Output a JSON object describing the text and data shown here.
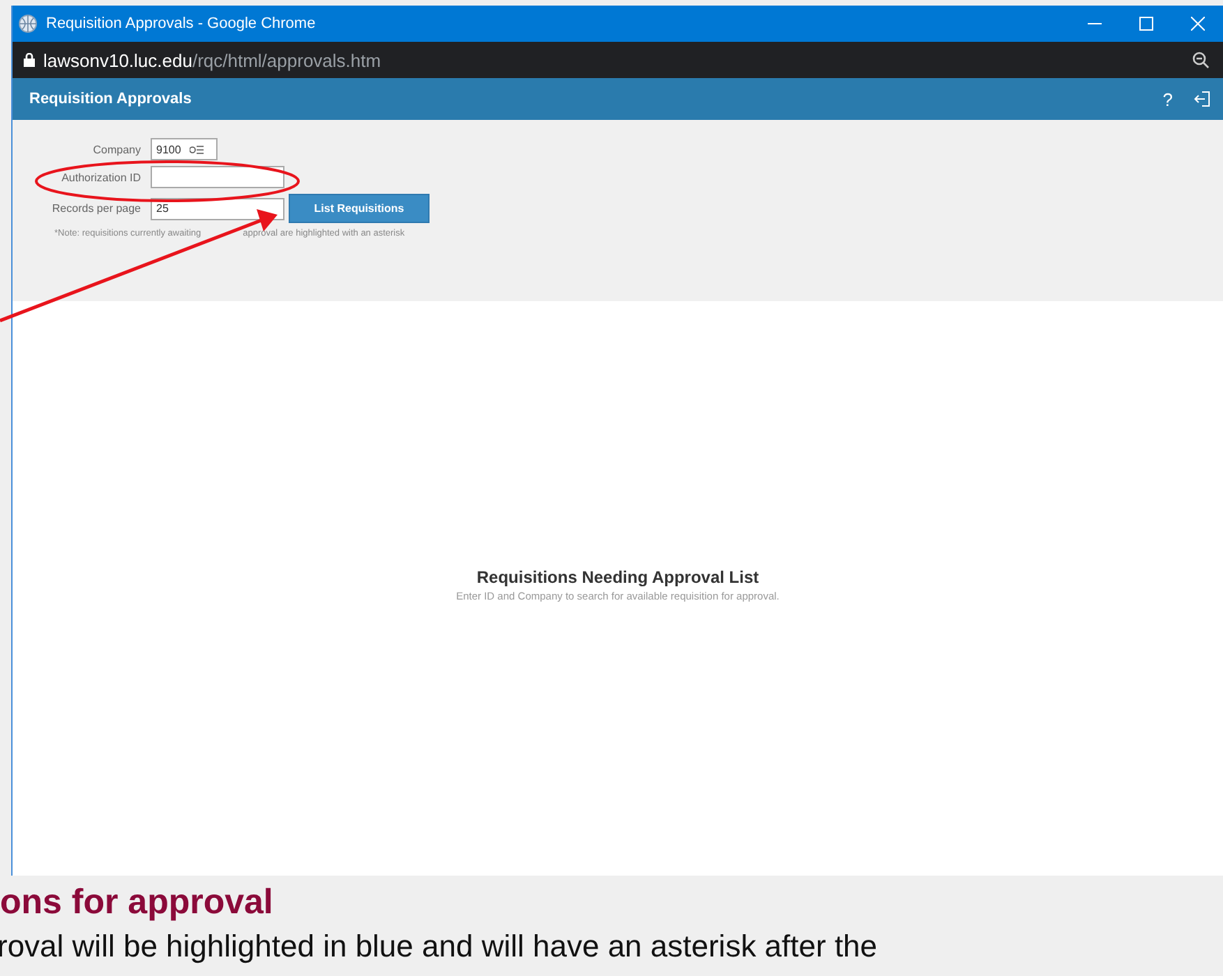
{
  "window": {
    "title": "Requisition Approvals - Google Chrome",
    "url_host": "lawsonv10.luc.edu",
    "url_path": "/rqc/html/approvals.htm"
  },
  "app": {
    "title": "Requisition Approvals",
    "help": "?"
  },
  "form": {
    "fields": [
      {
        "label": "Company",
        "value": "9100",
        "kind": "select"
      },
      {
        "label": "Authorization ID",
        "kind": "text"
      },
      {
        "label": "Records per page",
        "value": "25",
        "kind": "text"
      }
    ],
    "button": "List Requisitions",
    "note": [
      "*Note: requisitions currently awaiting",
      "approval are highlighted with an asterisk"
    ]
  },
  "empty_state": {
    "title": "Requisitions Needing Approval List",
    "message": "Enter ID and Company to search for available requisition for approval."
  },
  "document": {
    "heading": "ons for approval",
    "text": "roval will be highlighted in blue and will have an asterisk after the"
  }
}
